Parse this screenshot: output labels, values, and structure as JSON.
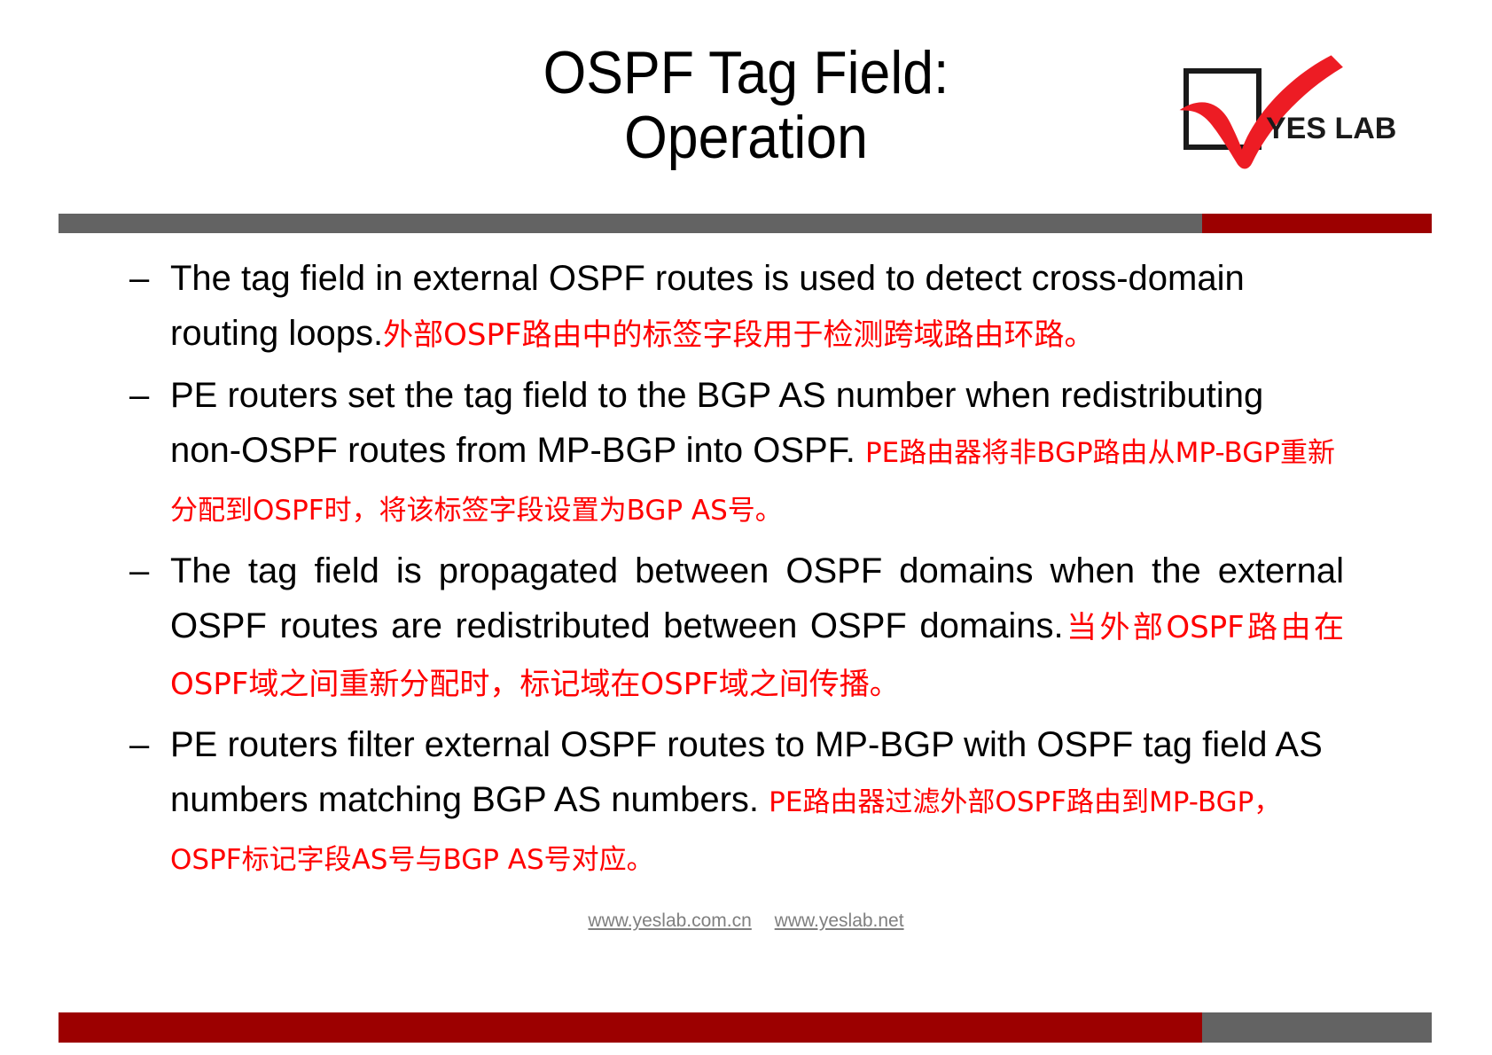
{
  "slide": {
    "title_line1": "OSPF Tag Field:",
    "title_line2": "Operation",
    "accent_gray": "#636363",
    "accent_red": "#9C0000",
    "chinese_red": "#FF0000"
  },
  "logo": {
    "text": "YES LAB",
    "alt": "yes-lab-checkmark-logo"
  },
  "bullets": [
    {
      "marker": "–",
      "en": "The tag field in external OSPF routes is used to detect cross-domain routing loops.",
      "cn": "外部OSPF路由中的标签字段用于检测跨域路由环路。"
    },
    {
      "marker": "–",
      "en": "PE routers set the tag field to the BGP AS number when redistributing non-OSPF routes from MP-BGP into OSPF. ",
      "cn": "PE路由器将非BGP路由从MP-BGP重新分配到OSPF时，将该标签字段设置为BGP AS号。"
    },
    {
      "marker": "–",
      "en": "The tag field is propagated between OSPF domains when  the external OSPF routes are redistributed between OSPF domains.",
      "cn": "当外部OSPF路由在OSPF域之间重新分配时，标记域在OSPF域之间传播。"
    },
    {
      "marker": "–",
      "en": "PE routers filter external OSPF routes to MP-BGP with OSPF  tag field AS numbers matching BGP AS numbers. ",
      "cn": "PE路由器过滤外部OSPF路由到MP-BGP， OSPF标记字段AS号与BGP AS号对应。"
    }
  ],
  "footer": {
    "link1": "www.yeslab.com.cn",
    "link2": "www.yeslab.net"
  }
}
